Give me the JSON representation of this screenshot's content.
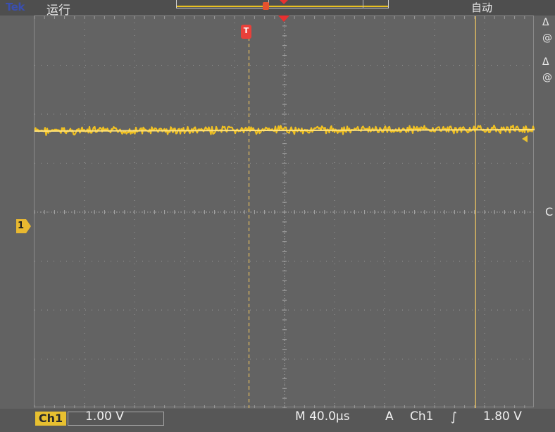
{
  "header": {
    "logo": "Tek",
    "run_status": "运行",
    "trigger_mode": "自动"
  },
  "markers": {
    "trigger_position": "T",
    "channel": "1"
  },
  "right_panel": {
    "delta_1": "Δ",
    "at_1": "@",
    "delta_2": "Δ",
    "at_2": "@",
    "c_label": "C"
  },
  "status_bar": {
    "channel_label": "Ch1",
    "volts_per_div": "1.00 V",
    "timebase": "M 40.0µs",
    "acquire_mode": "A",
    "trigger_source": "Ch1",
    "trigger_slope_symbol": "∫",
    "trigger_level": "1.80 V"
  },
  "colors": {
    "trace": "#f0c020",
    "trigger": "#e8403a",
    "cursor": "#e8c060"
  }
}
